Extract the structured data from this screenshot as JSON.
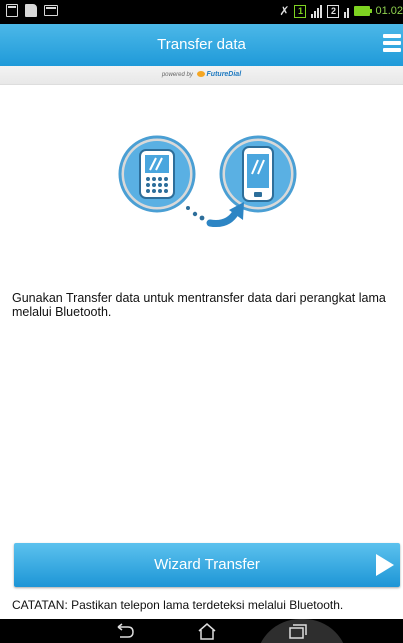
{
  "status_bar": {
    "time": "01.02",
    "sim_label": "1",
    "sim2_label": "2",
    "battery_color": "#7ed321"
  },
  "header": {
    "title": "Transfer data",
    "menu_icon": "menu-icon"
  },
  "powered_by": {
    "text": "powered by",
    "brand": "FutureDial"
  },
  "main": {
    "description": "Gunakan Transfer data untuk mentransfer data dari perangkat lama melalui Bluetooth.",
    "wizard_button_label": "Wizard Transfer",
    "note": "CATATAN: Pastikan telepon lama terdeteksi melalui Bluetooth."
  },
  "nav": {
    "back_icon": "back-icon",
    "home_icon": "home-icon",
    "recent_icon": "recent-apps-icon"
  },
  "colors": {
    "accent": "#1f9ad9",
    "header_top": "#4cb8e8"
  }
}
